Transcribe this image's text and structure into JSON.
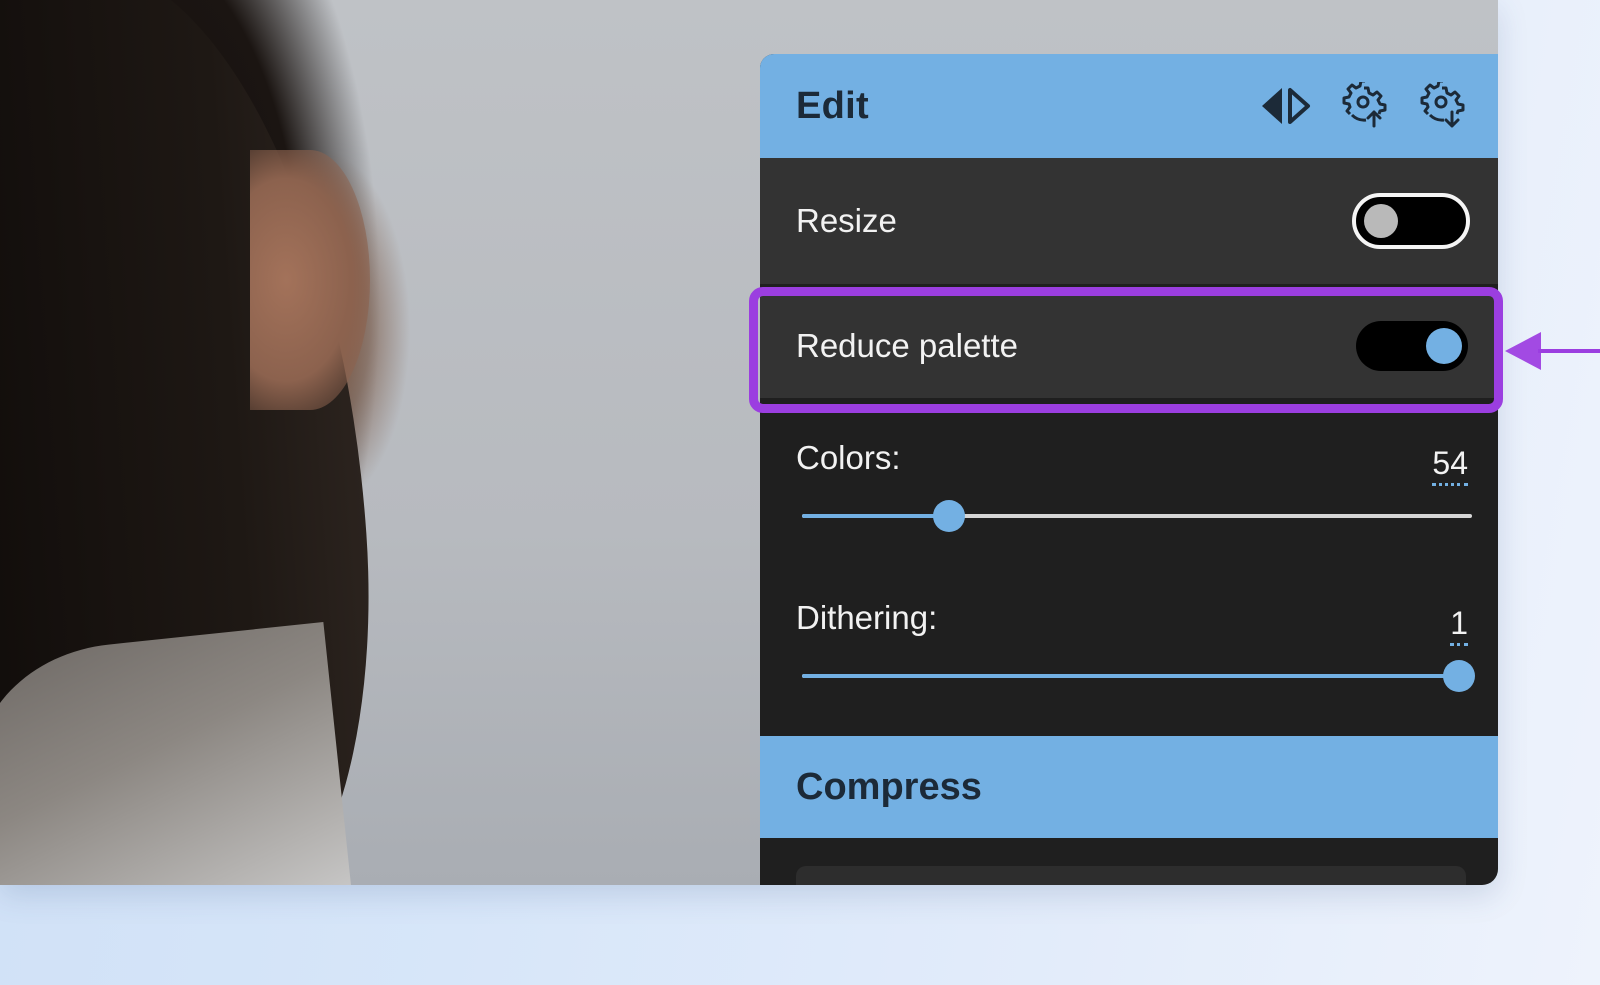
{
  "panel": {
    "title": "Edit",
    "icons": [
      "compare-icon",
      "settings-upload-icon",
      "settings-download-icon"
    ]
  },
  "resize": {
    "label": "Resize",
    "enabled": false
  },
  "reduce_palette": {
    "label": "Reduce palette",
    "enabled": true
  },
  "colors": {
    "label": "Colors:",
    "value": "54",
    "fraction": 0.22
  },
  "dithering": {
    "label": "Dithering:",
    "value": "1",
    "fraction": 0.98
  },
  "compress": {
    "title": "Compress"
  },
  "theme": {
    "accent": "#73b0e3",
    "highlight": "#9b3ee0",
    "panel_bg": "#1f1f1f",
    "row_bg": "#333333"
  }
}
